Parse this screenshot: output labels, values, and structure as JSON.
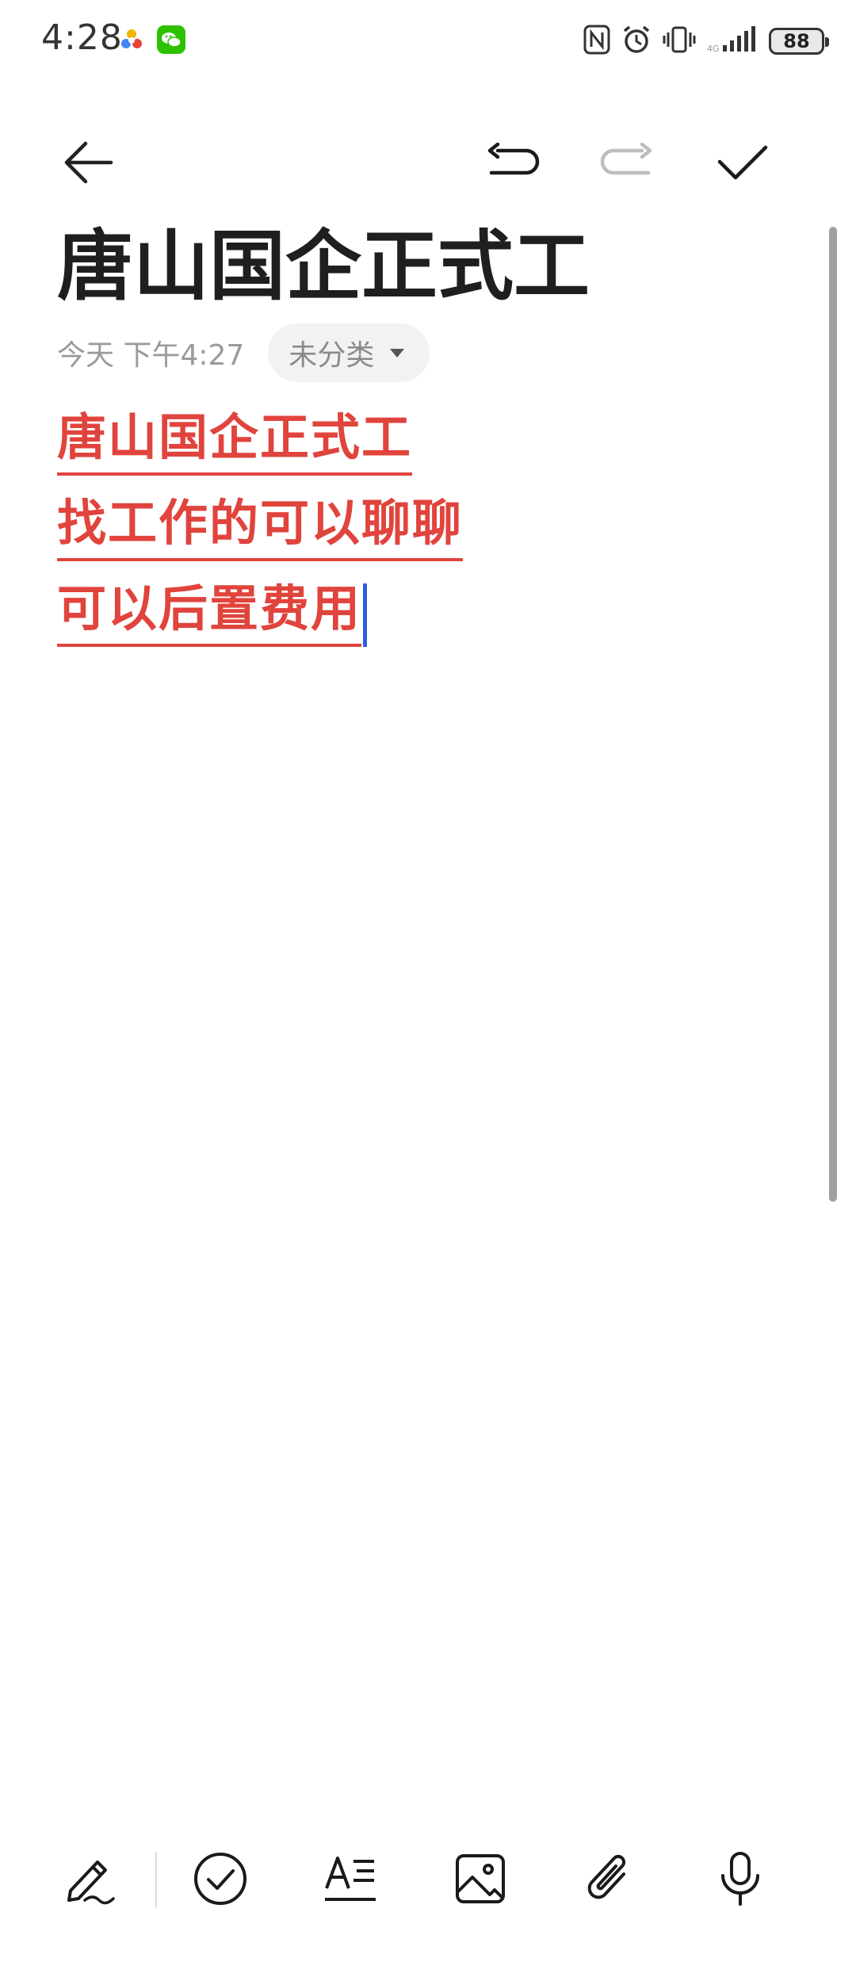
{
  "status_bar": {
    "time": "4:28",
    "battery": "88",
    "icons": [
      "nfc-icon",
      "alarm-icon",
      "vibrate-icon",
      "signal-icon"
    ]
  },
  "toolbar": {
    "back_icon": "back-arrow-icon",
    "undo_icon": "undo-icon",
    "redo_icon": "redo-icon",
    "done_icon": "check-icon"
  },
  "note": {
    "title": "唐山国企正式工",
    "date": "今天 下午4:27",
    "category": "未分类",
    "lines": [
      "唐山国企正式工",
      "找工作的可以聊聊",
      "可以后置费用"
    ]
  },
  "bottom_toolbar": {
    "items": [
      "handwriting-icon",
      "checklist-icon",
      "text-format-icon",
      "image-icon",
      "attachment-icon",
      "microphone-icon"
    ]
  },
  "colors": {
    "accent_text": "#e0443d",
    "cursor": "#2f5be0"
  }
}
